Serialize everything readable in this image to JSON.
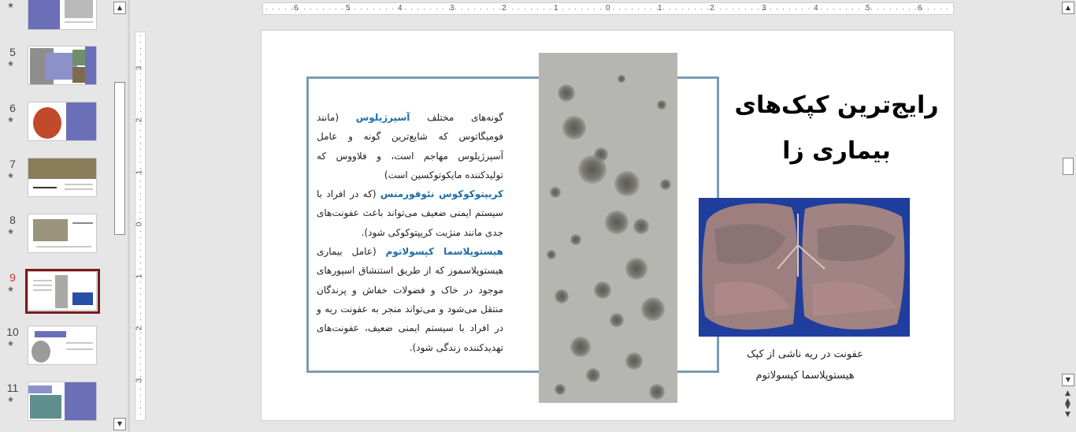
{
  "thumbnails": [
    {
      "number": "",
      "star": "★"
    },
    {
      "number": "5",
      "star": "★"
    },
    {
      "number": "6",
      "star": "★"
    },
    {
      "number": "7",
      "star": "★"
    },
    {
      "number": "8",
      "star": "★"
    },
    {
      "number": "9",
      "star": "★"
    },
    {
      "number": "10",
      "star": "★"
    },
    {
      "number": "11",
      "star": "★"
    }
  ],
  "selected_slide": "9",
  "ruler": {
    "horizontal": [
      "6",
      "5",
      "4",
      "3",
      "2",
      "1",
      "0",
      "1",
      "2",
      "3",
      "4",
      "5",
      "6"
    ],
    "vertical": [
      "3",
      "2",
      "1",
      "0",
      "1",
      "2",
      "3"
    ]
  },
  "slide": {
    "title_line1": "رایج‌ترین کپک‌های",
    "title_line2": "بیماری زا",
    "body": {
      "p1_pre": "گونه‌های مختلف ",
      "p1_hl": "آسپرژیلوس",
      "p1_post": " (مانند فومیگاتوس که شایع‌ترین گونه و عامل آسپرژیلوس مهاجم است، و فلاووس که تولیدکننده مایکوتوکسین است)",
      "p2_hl": "کریپتوکوکوس نئوفورمنس",
      "p2_post": " (که در افراد با سیستم ایمنی ضعیف می‌تواند باعث عفونت‌های جدی مانند منژیت کریپتوکوکی شود).",
      "p3_hl": "هیستوپلاسما کپسولاتوم",
      "p3_post": " (عامل بیماری هیستوپلاسموز که از طریق استنشاق اسپورهای موجود در خاک و فضولات خفاش و پرندگان منتقل می‌شود و می‌تواند منجر به عفونت ریه و در افراد با سیستم ایمنی ضعیف، عفونت‌های تهدیدکننده زندگی شود)."
    },
    "caption_line1": "عفونت در ریه ناشی از کپک",
    "caption_line2": "هیستوپلاسما کپسولاتوم"
  },
  "icons": {
    "scroll_up": "scroll-up-icon",
    "scroll_down": "scroll-down-icon",
    "prev_slide": "previous-slide-icon",
    "next_slide": "next-slide-icon",
    "star": "transition-star-icon"
  },
  "colors": {
    "accent_text": "#1b6ea8",
    "frame_border": "#7b9bb4",
    "selection_border": "#7b1c1c",
    "selected_number": "#c0392b"
  }
}
